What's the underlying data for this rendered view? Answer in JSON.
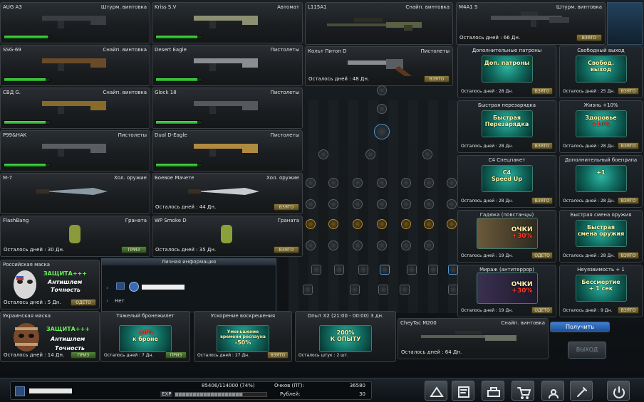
{
  "left_weapons": [
    {
      "name": "AUG A3",
      "type": "Штурм. винтовка",
      "bar": 0.95
    },
    {
      "name": "Kriss S.V",
      "type": "Автомат",
      "bar": 0.9
    },
    {
      "name": "SSG-69",
      "type": "Снайп. винтовка",
      "bar": 0.9
    },
    {
      "name": "Desert Eagle",
      "type": "Пистолеты",
      "bar": 0.9
    },
    {
      "name": "СВД G.",
      "type": "Снайп. винтовка",
      "bar": 0.9
    },
    {
      "name": "Glock 18",
      "type": "Пистолеты",
      "bar": 0.9
    },
    {
      "name": "P99&HAK",
      "type": "Пистолеты",
      "bar": 0.9
    },
    {
      "name": "Dual D-Eagle",
      "type": "Пистолеты",
      "bar": 0.9
    },
    {
      "name": "M-7",
      "type": "Хол. оружие"
    },
    {
      "name": "Боевое Мачете",
      "type": "Хол. оружие",
      "days": "Осталось дней : 44 Дн.",
      "button": "ВЗЯТО"
    },
    {
      "name": "FlashBang",
      "type": "Граната",
      "days": "Осталось дней : 30 Дн.",
      "button": "ПРИЗ"
    },
    {
      "name": "WP Smoke D",
      "type": "Граната",
      "days": "Осталось дней : 35 Дн.",
      "button": "ВЗЯТО"
    }
  ],
  "center_top": [
    {
      "name": "L115A1",
      "type": "Снайп. винтовка"
    },
    {
      "name": "Кольт Питон D",
      "type": "Пистолеты",
      "days": "Осталось дней : 48 Дн.",
      "button": "ВЗЯТО"
    }
  ],
  "m4a1": {
    "name": "M4A1 S",
    "type": "Штурм. винтовка",
    "days": "Осталось дней : 66 Дн.",
    "button": "ВЗЯТО"
  },
  "right_items": [
    {
      "name": "Дополнительные патроны",
      "days": "Осталось дней : 28 Дн.",
      "button": "ВЗЯТО",
      "art_l1": "Доп. патроны",
      "art_l2": ""
    },
    {
      "name": "Свободный выход",
      "days": "Осталось дней : 25 Дн.",
      "button": "ВЗЯТО",
      "art_l1": "Свобод.",
      "art_l2": "выход"
    },
    {
      "name": "Быстрая перезарядка",
      "days": "Осталось дней : 28 Дн.",
      "button": "ВЗЯТО",
      "art_l1": "Быстрая",
      "art_l2": "Перезарядка"
    },
    {
      "name": "Жизнь +10%",
      "days": "Осталось дней : 28 Дн.",
      "button": "ВЗЯТО",
      "art_l1": "Здоровье",
      "art_l2": "+10%"
    },
    {
      "name": "C4 Спецпакет",
      "days": "Осталось дней : 28 Дн.",
      "button": "ВЗЯТО",
      "art_l1": "C4",
      "art_l2": "Speed Up"
    },
    {
      "name": "Дополнительный боеприпа",
      "days": "Осталось дней : 28 Дн.",
      "button": "ВЗЯТО",
      "art_l1": "+1",
      "art_l2": ""
    },
    {
      "name": "Гадюка (повстанцы)",
      "days": "Осталось дней : 19 Дн.",
      "button": "ОДЕТО",
      "art_l1": "ОЧКИ",
      "art_l2": "+30%"
    },
    {
      "name": "Быстрая смена оружия",
      "days": "Осталось дней : 28 Дн.",
      "button": "ВЗЯТО",
      "art_l1": "Быстрая",
      "art_l2": "смена оружия"
    },
    {
      "name": "Мираж (антитеррор)",
      "days": "Осталось дней : 19 Дн.",
      "button": "ОДЕТО",
      "art_l1": "ОЧКИ",
      "art_l2": "+30%"
    },
    {
      "name": "Неуязвимость + 1",
      "days": "Осталось дней : 9 Дн.",
      "button": "ВЗЯТО",
      "art_l1": "Бессмертие",
      "art_l2": "+ 1 сек"
    }
  ],
  "masks": [
    {
      "name": "Российская маска",
      "days": "Осталось дней : 5 Дн.",
      "button": "ОДЕТО",
      "l1": "ЗАЩИТА+++",
      "l2": "Антишлем",
      "l3": "Точность"
    },
    {
      "name": "Украинская маска",
      "days": "Осталось дней : 14 Дн.",
      "button": "ПРИЗ",
      "l1": "ЗАЩИТА+++",
      "l2": "Антишлем",
      "l3": "Точность"
    }
  ],
  "boosts": [
    {
      "name": "Тяжелый бронежилет",
      "days": "Осталось дней : 7 Дн.",
      "button": "ПРИЗ",
      "l1": "-10%",
      "l2": "к броне"
    },
    {
      "name": "Ускорение воскрешения",
      "days": "Осталось дней : 27 Дн.",
      "button": "ВЗЯТО",
      "l1": "Уменьшение времени респауна",
      "l2": "-50%"
    },
    {
      "name": "Опыт X2 (21:00 - 00:00) 3 дн.",
      "days": "Осталось штук : 2 шт.",
      "button": "",
      "l1": "200%",
      "l2": "К ОПЫТУ"
    }
  ],
  "cheytac": {
    "name": "CheyTac M200",
    "type": "Снайп. винтовка",
    "days": "Осталось дней : 64 Дн."
  },
  "personal": {
    "title": "Личная информация",
    "row2": "Нет"
  },
  "actions": {
    "get": "Получить",
    "exit": "ВЫХОД"
  },
  "status": {
    "exp": "85406/114000 (74%)",
    "exp_label": "EXP",
    "exp_fill": 0.74,
    "points_label": "Очков (ПТ):",
    "points": "36580",
    "rub_label": "Рублей:",
    "rub": "30"
  },
  "bottom_icons": [
    "inventory-icon",
    "edit-icon",
    "shop-icon",
    "cart-icon",
    "community-icon",
    "settings-icon",
    "power-icon"
  ],
  "colors": {
    "accent": "#3a7fd1",
    "bar": "#3ec43e"
  }
}
